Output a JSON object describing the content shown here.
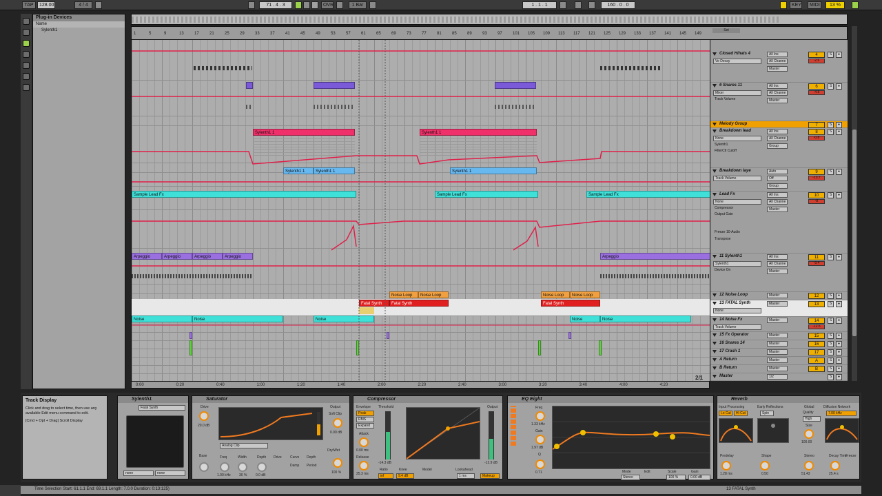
{
  "transport": {
    "tap": "TAP",
    "tempo": "128.00",
    "signature": "4 / 4",
    "position": "71 . 4 . 3",
    "ovr": "OVR",
    "quantize": "1 Bar",
    "loop_start": "1 . 1 . 1",
    "loop_length": "160 . 0 . 0",
    "key": "KEY",
    "midi": "MIDI",
    "cpu": "13 %"
  },
  "browser": {
    "title": "Plug-in Devices",
    "item": "Sylenth1",
    "col_name": "Name"
  },
  "ruler": {
    "bars": [
      "1",
      "5",
      "9",
      "13",
      "17",
      "21",
      "25",
      "29",
      "33",
      "37",
      "41",
      "45",
      "49",
      "53",
      "57",
      "61",
      "65",
      "69",
      "73",
      "77",
      "81",
      "85",
      "89",
      "93",
      "97",
      "101",
      "105",
      "109",
      "113",
      "117",
      "121",
      "125",
      "129",
      "133",
      "137",
      "141",
      "145",
      "149"
    ],
    "set_label": "Set"
  },
  "timeline": [
    "0:00",
    "0:20",
    "0:40",
    "1:00",
    "1:20",
    "1:40",
    "2:00",
    "2:20",
    "2:40",
    "3:00",
    "3:20",
    "3:40",
    "4:00",
    "4:20"
  ],
  "page_indicator": "2/1",
  "clips": {
    "sylenth": "Sylenth1 1",
    "sample_lead": "Sample Lead Fx",
    "arpeggio": "Arpeggio",
    "noise_loop": "Noise Loop",
    "fatal": "Fatal Synth",
    "noise": "Noise"
  },
  "mixer": {
    "tracks": [
      {
        "name": "Closed Hihats 4",
        "sub": "Ve Decay",
        "num": "4",
        "vol": "-2.6",
        "input": "All Ins",
        "chan": "All Channe",
        "out": "Master"
      },
      {
        "name": "6 Snares 11",
        "sub": "Mixer",
        "sub2": "Track Volume",
        "num": "6",
        "vol": "-4.8",
        "input": "All Ins",
        "chan": "All Channe",
        "out": "Master"
      },
      {
        "name": "Melody Group",
        "num": "7",
        "vol": "",
        "group": true
      },
      {
        "name": "Breakdown lead",
        "sub": "None",
        "sub2": "Sylenth1",
        "sub3": "FilterCtl Cutoff",
        "num": "8",
        "vol": "-0.8",
        "input": "All Ins",
        "chan": "All Channe",
        "out": "Group"
      },
      {
        "name": "Breakdown laye",
        "sub": "Track Volume",
        "num": "9",
        "vol": "-13.7",
        "input": "Auto",
        "chan": "Off",
        "out": "Group"
      },
      {
        "name": "Lead Fx",
        "sub": "None",
        "sub2": "Compressor",
        "sub3": "Output Gain",
        "sub4": "Freeze 10-Audio",
        "sub5": "Transpose",
        "num": "10",
        "vol": "-8",
        "input": "All Ins",
        "chan": "All Channe",
        "out": "Master"
      },
      {
        "name": "11 Sylenth1",
        "sub": "Sylenth1",
        "sub2": "Device On",
        "num": "11",
        "vol": "-9.4",
        "input": "All Ins",
        "chan": "All Channe",
        "out": "Master"
      },
      {
        "name": "12 Noise Loop",
        "num": "12",
        "vol": "",
        "out": "Master"
      },
      {
        "name": "13 FATAL Synth",
        "sub": "None",
        "num": "13",
        "vol": "",
        "out": "Master"
      },
      {
        "name": "14 Noise Fx",
        "sub": "Track Volume",
        "num": "14",
        "vol": "-12.5",
        "out": "Master"
      },
      {
        "name": "15 Fx Operator",
        "num": "15",
        "vol": "",
        "out": "Master"
      },
      {
        "name": "16 Snares 14",
        "num": "16",
        "vol": "",
        "out": "Master"
      },
      {
        "name": "17 Crash 1",
        "num": "17",
        "vol": "",
        "out": "Master"
      },
      {
        "name": "A Return",
        "num": "A",
        "vol": "",
        "out": "Master"
      },
      {
        "name": "B Return",
        "num": "B",
        "vol": "",
        "out": "Master"
      },
      {
        "name": "Master",
        "num": "",
        "vol": "-0.3",
        "out": "1/2"
      }
    ]
  },
  "info": {
    "title": "Track Display",
    "text": "Click and drag to select time, then use any available Edit menu command to edit.",
    "shortcut": "[Cmd + Opt + Drag] Scroll Display"
  },
  "devices": {
    "sylenth": {
      "title": "Sylenth1",
      "preset": "Fatal Synth",
      "none1": "none",
      "none2": "none"
    },
    "saturator": {
      "title": "Saturator",
      "mode": "Analog Clip",
      "drive": "Drive",
      "output": "Output",
      "soft_clip": "Soft Clip",
      "dry_wet": "Dry/Wet",
      "base": "Base",
      "freq": "Freq",
      "width": "Width",
      "depth": "Depth",
      "drive2": "Drive",
      "curve": "Curve",
      "damp": "Damp",
      "period": "Period",
      "drive_val": "20.0 dB",
      "output_val": "0.00 dB",
      "freq_val": "1.00 kHz",
      "width_val": "30 %",
      "depth_val": "0.0 dB",
      "dw_val": "100 %"
    },
    "compressor": {
      "title": "Compressor",
      "envelope": "Envelope",
      "peak": "Peak",
      "rms": "RMS",
      "expand": "Expand",
      "threshold": "Threshold",
      "output": "Output",
      "attack": "Attack",
      "release": "Release",
      "ratio": "Ratio",
      "knee": "Knee",
      "model": "Model",
      "lookahead": "Lookahead",
      "makeup": "Makeup",
      "thr_val": "-14.3 dB",
      "out_val": "-12.9 dB",
      "attack_val": "0.00 ms",
      "release_val": "25.3 ms",
      "ratio_val": "inf",
      "knee_val": "9.4 dB",
      "lookahead_val": "1 ms"
    },
    "eq": {
      "title": "EQ Eight",
      "freq": "Freq",
      "gain": "Gain",
      "q": "Q",
      "freq_val": "1.33 kHz",
      "gain_val": "1.97 dB",
      "q_val": "0.71",
      "mode": "Mode",
      "edit": "Edit",
      "scale": "Scale",
      "adapt": "Adapt Q",
      "mode_val": "Stereo",
      "scale_val": "100 %",
      "adapt_val": "0.00 dB"
    },
    "reverb": {
      "title": "Reverb",
      "input": "Input Processing",
      "early": "Early Reflections",
      "global": "Global",
      "diffusion": "Diffusion Network",
      "lo_cut": "Lo Cut",
      "hi_cut": "Hi Cut",
      "spin": "Spin",
      "quality": "Quality",
      "high": "High",
      "size": "Size",
      "predelay": "Predelay",
      "shape": "Shape",
      "stereo": "Stereo",
      "decay": "Decay Time",
      "freeze": "Freeze",
      "predelay_val": "1.28 ms",
      "shape_val": "0.50",
      "stereo_val": "51.43",
      "decay_val": "25.4 s",
      "size_val": "100.00",
      "hi_val": "7.00 kHz"
    }
  },
  "status": {
    "left": "Time Selection   Start: 61.1.1   End: 69.1.1   Length: 7.0.0   Duration: 0:13:125)",
    "right": "13 FATAL Synth"
  },
  "colors": {
    "automation": "#e0204a",
    "purple": "#7a5ad8",
    "cyan": "#3ee0d8",
    "pink": "#f0306a",
    "orange": "#f0a040",
    "red": "#e02020",
    "green": "#60d040",
    "blue": "#68b8f0"
  }
}
